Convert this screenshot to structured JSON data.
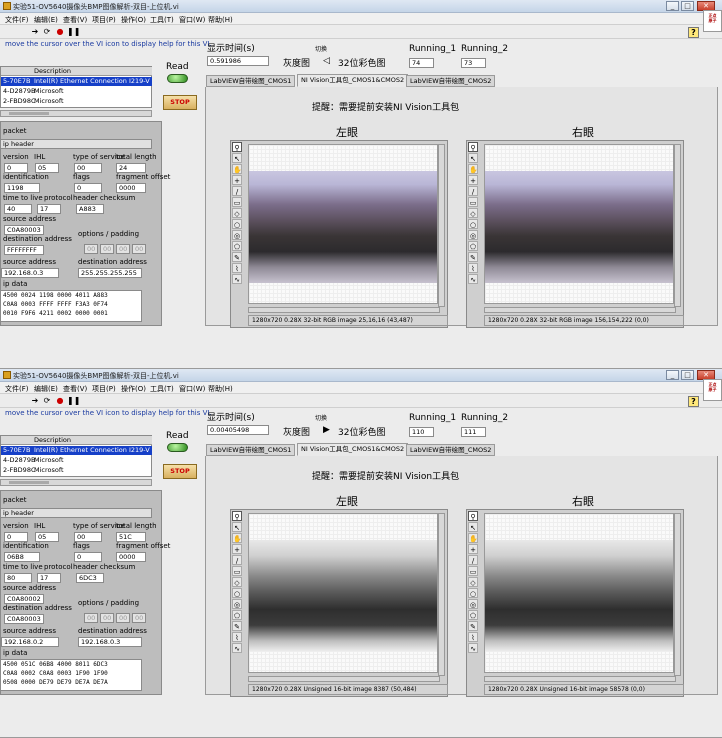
{
  "app": {
    "title_top": "实验51-OV5640摄像头BMP图像解析-双目-上位机.vi",
    "title_bottom": "实验51-OV5640摄像头BMP图像解析-双目-上位机.vi",
    "hint": "move the cursor over the VI icon to display help for this VI.",
    "logo_text": "正点原子 ZhiYan DaMai",
    "window_controls": [
      "_",
      "□",
      "✕"
    ]
  },
  "menu": [
    "文件(F)",
    "编辑(E)",
    "查看(V)",
    "项目(P)",
    "操作(O)",
    "工具(T)",
    "窗口(W)",
    "帮助(H)"
  ],
  "toolbar_icons": [
    "run-arrow-icon",
    "run-continuous-icon",
    "abort-icon",
    "pause-icon"
  ],
  "labels": {
    "display_time": "显示时间(s)",
    "switch": "切换",
    "grayscale": "灰度图",
    "color32": "32位彩色图",
    "running1": "Running_1",
    "running2": "Running_2",
    "read": "Read",
    "stop": "STOP",
    "notice": "提醒：需要提前安装NI Vision工具包",
    "left_eye": "左眼",
    "right_eye": "右眼",
    "packet": "packet",
    "ip_header": "ip header",
    "version": "version",
    "ihl": "IHL",
    "type_of_service": "type of service",
    "total_length": "total length",
    "identification": "identification",
    "flags": "flags",
    "fragment_offset": "fragment offset",
    "time_to_live": "time to live",
    "protocol": "protocol",
    "header_checksum": "header checksum",
    "source_address": "source address",
    "destination_address": "destination address",
    "options_padding": "options / padding",
    "source_address2": "source address",
    "destination_address2": "destination address",
    "ip_data": "ip data",
    "list_col2": "Description"
  },
  "tabs": [
    "LabVIEW自带绘图_CMOS1",
    "NI Vision工具包_CMOS1&CMOS2",
    "LabVIEW自带绘图_CMOS2"
  ],
  "viewer_tools": [
    "zoom-icon",
    "pointer-icon",
    "pan-icon",
    "crosshair-icon",
    "line-icon",
    "rectangle-icon",
    "rotated-rect-icon",
    "oval-icon",
    "annulus-icon",
    "polygon-icon",
    "freehand-icon",
    "broken-line-icon",
    "free-line-icon"
  ],
  "top": {
    "display_time": "0.591986",
    "running1": "74",
    "running2": "73",
    "list": [
      {
        "c1": "5-70E7B",
        "c2": "Intel(R) Ethernet Connection I219-V",
        "selected": true
      },
      {
        "c1": "4-D2879B",
        "c2": "Microsoft",
        "selected": false
      },
      {
        "c1": "2-FBD98C",
        "c2": "Microsoft",
        "selected": false
      }
    ],
    "version": "0",
    "ihl": "05",
    "tos": "00",
    "total_length": "24",
    "identification": "1198",
    "flags": "0",
    "fragment_offset": "0000",
    "ttl": "40",
    "protocol": "17",
    "header_checksum": "A883",
    "source_hex": "C0A80003",
    "dest_hex": "FFFFFFFF",
    "options": [
      "00",
      "00",
      "00",
      "00"
    ],
    "source_ip": "192.168.0.3",
    "dest_ip": "255.255.255.255",
    "ip_data": [
      "4500 0024 1198 0000 4011 A883",
      "C0A8 0003 FFFF FFFF F3A3 0F74",
      "0010 F9F6 4211 0002 0000 0001"
    ],
    "left_status": "1280x720 0.28X 32-bit RGB image 25,16,16     (43,487)",
    "right_status": "1280x720 0.28X 32-bit RGB image 156,154,222    (0,0)"
  },
  "bottom": {
    "display_time": "0.00405498",
    "running1": "110",
    "running2": "111",
    "list": [
      {
        "c1": "5-70E7B",
        "c2": "Intel(R) Ethernet Connection I219-V",
        "selected": true
      },
      {
        "c1": "4-D2879B",
        "c2": "Microsoft",
        "selected": false
      },
      {
        "c1": "2-FBD98C",
        "c2": "Microsoft",
        "selected": false
      }
    ],
    "version": "0",
    "ihl": "05",
    "tos": "00",
    "total_length": "51C",
    "identification": "06B8",
    "flags": "0",
    "fragment_offset": "0000",
    "ttl": "80",
    "protocol": "17",
    "header_checksum": "6DC3",
    "source_hex": "C0A80002",
    "dest_hex": "C0A80003",
    "options": [
      "00",
      "00",
      "00",
      "00"
    ],
    "source_ip": "192.168.0.2",
    "dest_ip": "192.168.0.3",
    "ip_data": [
      "4500 051C 06B8 4000 8011 6DC3",
      "C0A8 0002 C0A8 0003 1F90 1F90",
      "0508 0000 DE79 DE79 DE7A DE7A"
    ],
    "left_status": "1280x720 0.28X Unsigned 16-bit image 8387     (50,484)",
    "right_status": "1280x720 0.28X Unsigned 16-bit image 58578     (0,0)"
  }
}
